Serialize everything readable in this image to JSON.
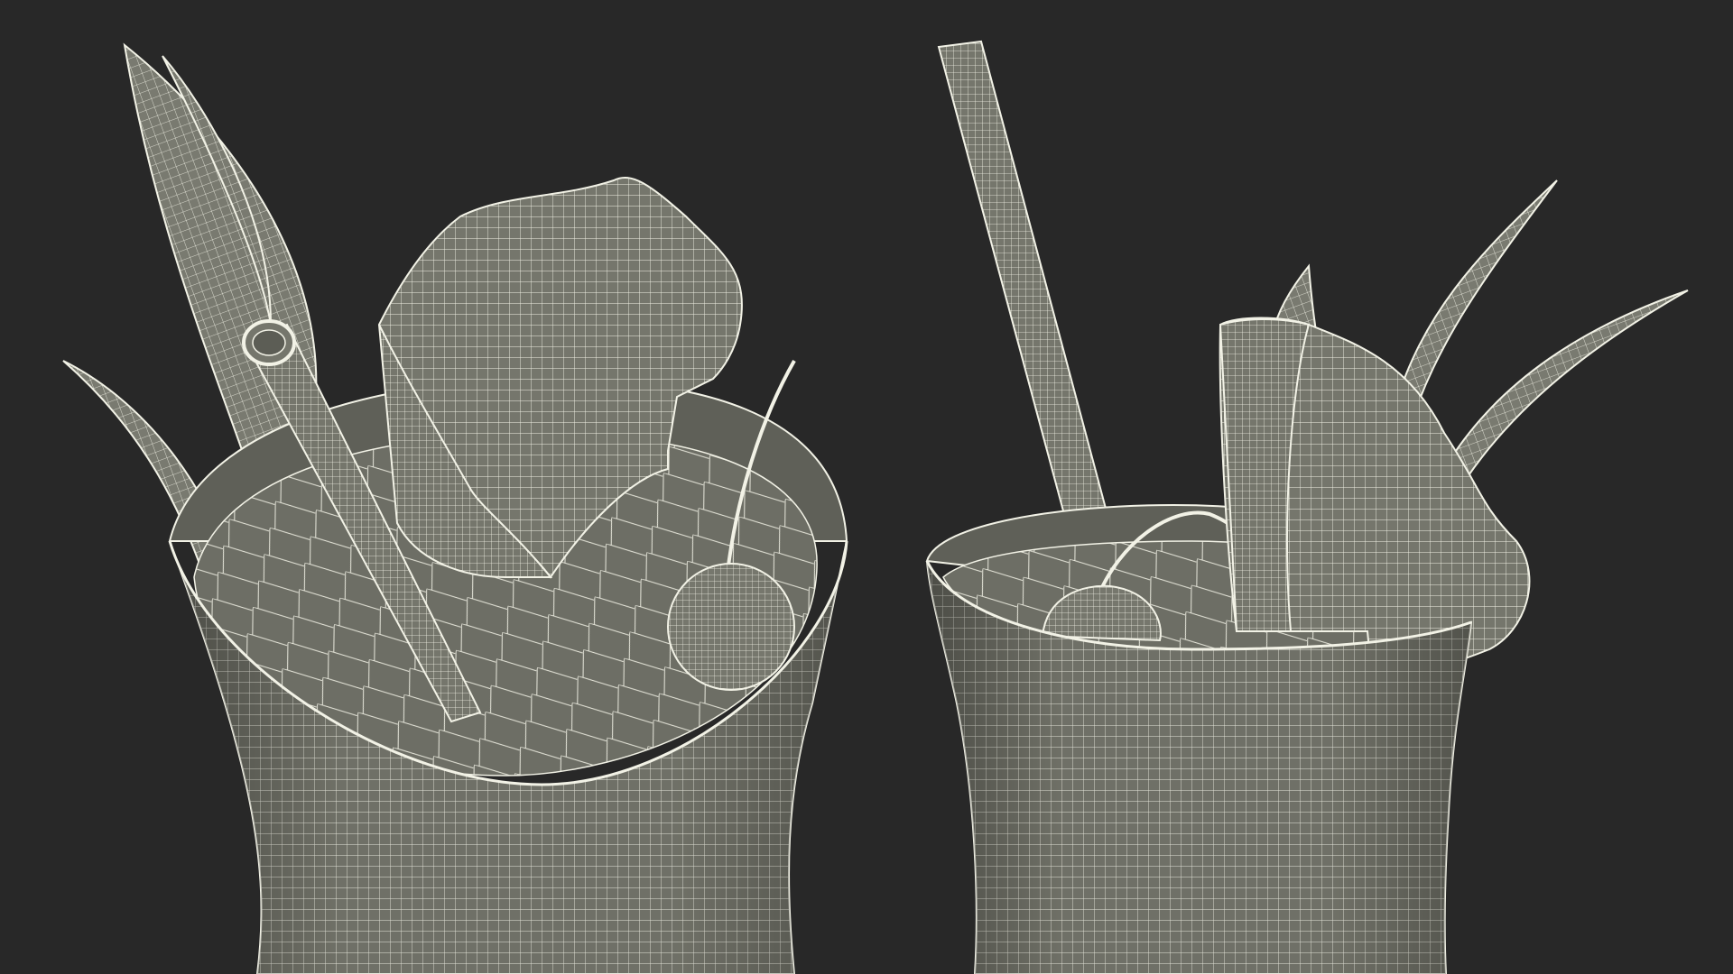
{
  "scene": {
    "background_color": "#282828",
    "surface_color": "#75766c",
    "surface_dark_color": "#5f6058",
    "wire_color": "#f2f2e6",
    "objects": [
      {
        "name": "cocktail-glass-left-view",
        "items": [
          "glass",
          "liquid-surface",
          "straw",
          "pineapple-wedge",
          "pineapple-leaves",
          "cherry"
        ]
      },
      {
        "name": "cocktail-glass-right-view",
        "items": [
          "glass",
          "liquid-surface",
          "straw",
          "pineapple-wedge",
          "pineapple-leaves",
          "cherry"
        ]
      }
    ]
  }
}
